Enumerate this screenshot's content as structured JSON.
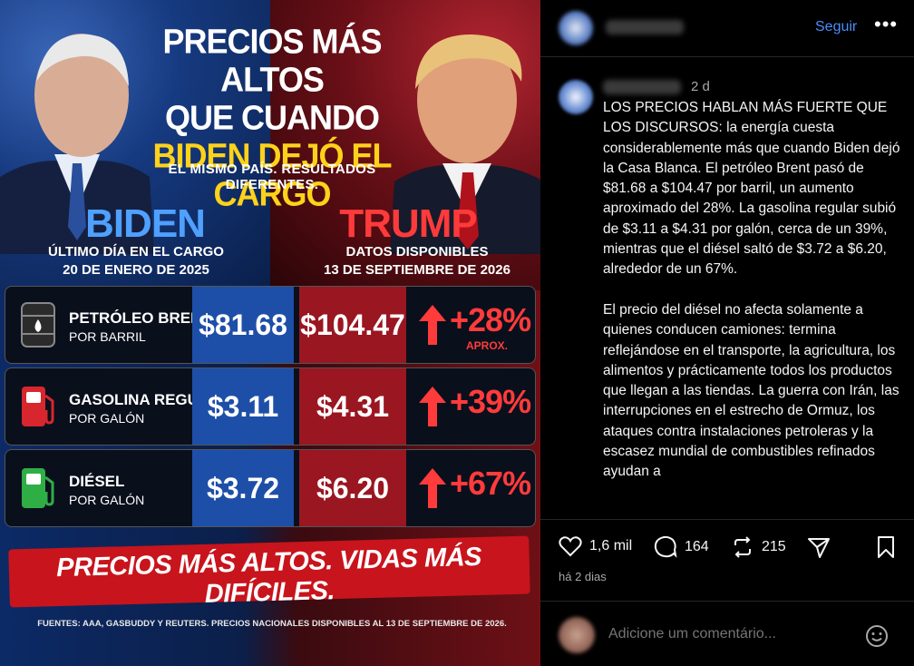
{
  "graphic": {
    "headline_lines": [
      "PRECIOS MÁS ALTOS",
      "QUE CUANDO",
      "BIDEN DEJÓ EL CARGO"
    ],
    "subhead": "EL MISMO PAÍS. RESULTADOS DIFERENTES.",
    "left_name": "BIDEN",
    "left_caption_1": "ÚLTIMO DÍA EN EL CARGO",
    "left_caption_2": "20 DE ENERO DE 2025",
    "right_name": "TRUMP",
    "right_caption_1": "DATOS DISPONIBLES",
    "right_caption_2": "13 DE SEPTIEMBRE DE 2026",
    "rows": [
      {
        "label": "PETRÓLEO BRENT",
        "unit": "POR BARRIL",
        "old": "$81.68",
        "new": "$104.47",
        "change": "+28%",
        "note": "APROX.",
        "icon": "oil-barrel-icon"
      },
      {
        "label": "GASOLINA REGULAR",
        "unit": "POR GALÓN",
        "old": "$3.11",
        "new": "$4.31",
        "change": "+39%",
        "note": "",
        "icon": "gas-pump-red-icon"
      },
      {
        "label": "DIÉSEL",
        "unit": "POR GALÓN",
        "old": "$3.72",
        "new": "$6.20",
        "change": "+67%",
        "note": "",
        "icon": "gas-pump-green-icon"
      }
    ],
    "banner": "PRECIOS MÁS ALTOS. VIDAS MÁS DIFÍCILES.",
    "sources": "FUENTES: AAA, GASBUDDY Y REUTERS. PRECIOS NACIONALES DISPONIBLES AL 13 DE SEPTIEMBRE DE 2026.",
    "colors": {
      "biden_blue": "#4fa0ff",
      "trump_red": "#ff3a3a",
      "yellow": "#ffd21a",
      "banner_red": "#c8141c"
    }
  },
  "panel": {
    "follow_label": "Seguir",
    "more_label": "•••",
    "comment_time": "2 d",
    "caption": "LOS PRECIOS HABLAN MÁS FUERTE QUE LOS DISCURSOS: la energía cuesta considerablemente más que cuando Biden dejó la Casa Blanca. El petróleo Brent pasó de $81.68 a $104.47 por barril, un aumento aproximado del 28%. La gasolina regular subió de $3.11 a $4.31 por galón, cerca de un 39%, mientras que el diésel saltó de $3.72 a $6.20, alrededor de un 67%.\n\nEl precio del diésel no afecta solamente a quienes conducen camiones: termina reflejándose en el transporte, la agricultura, los alimentos y prácticamente todos los productos que llegan a las tiendas. La guerra con Irán, las interrupciones en el estrecho de Ormuz, los ataques contra instalaciones petroleras y la escasez mundial de combustibles refinados ayudan a",
    "likes": "1,6 mil",
    "comments": "164",
    "reposts": "215",
    "posted": "há 2 dias",
    "comment_placeholder": "Adicione um comentário..."
  }
}
